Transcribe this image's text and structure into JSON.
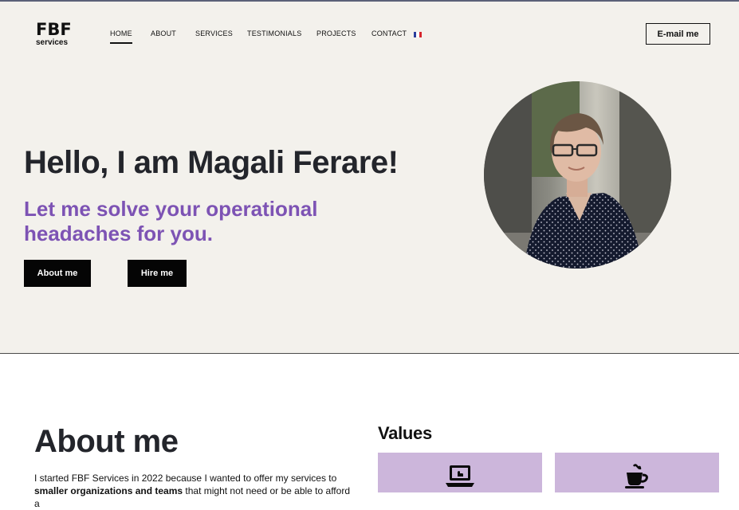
{
  "logo": {
    "main": "FBF",
    "sub": "services"
  },
  "nav": [
    {
      "label": "HOME"
    },
    {
      "label": "ABOUT"
    },
    {
      "label": "SERVICES"
    },
    {
      "label": "TESTIMONIALS"
    },
    {
      "label": "PROJECTS"
    },
    {
      "label": "CONTACT"
    }
  ],
  "language_flag": "fr-flag-icon",
  "email_button": "E-mail me",
  "hero": {
    "title": "Hello, I am Magali Ferare!",
    "subtitle": "Let me solve your operational headaches for you.",
    "about_button": "About me",
    "hire_button": "Hire me"
  },
  "about": {
    "title": "About me",
    "text_start": "I started FBF Services in 2022 because I wanted to offer my services to ",
    "text_bold": "smaller organizations and teams",
    "text_end": " that might not need or be able to afford a"
  },
  "values": {
    "title": "Values",
    "icons": [
      "laptop-icon",
      "coffee-cup-icon"
    ]
  },
  "colors": {
    "hero_bg": "#f3f1ec",
    "accent_purple": "#7d53b4",
    "card_purple": "#ccb6db"
  }
}
